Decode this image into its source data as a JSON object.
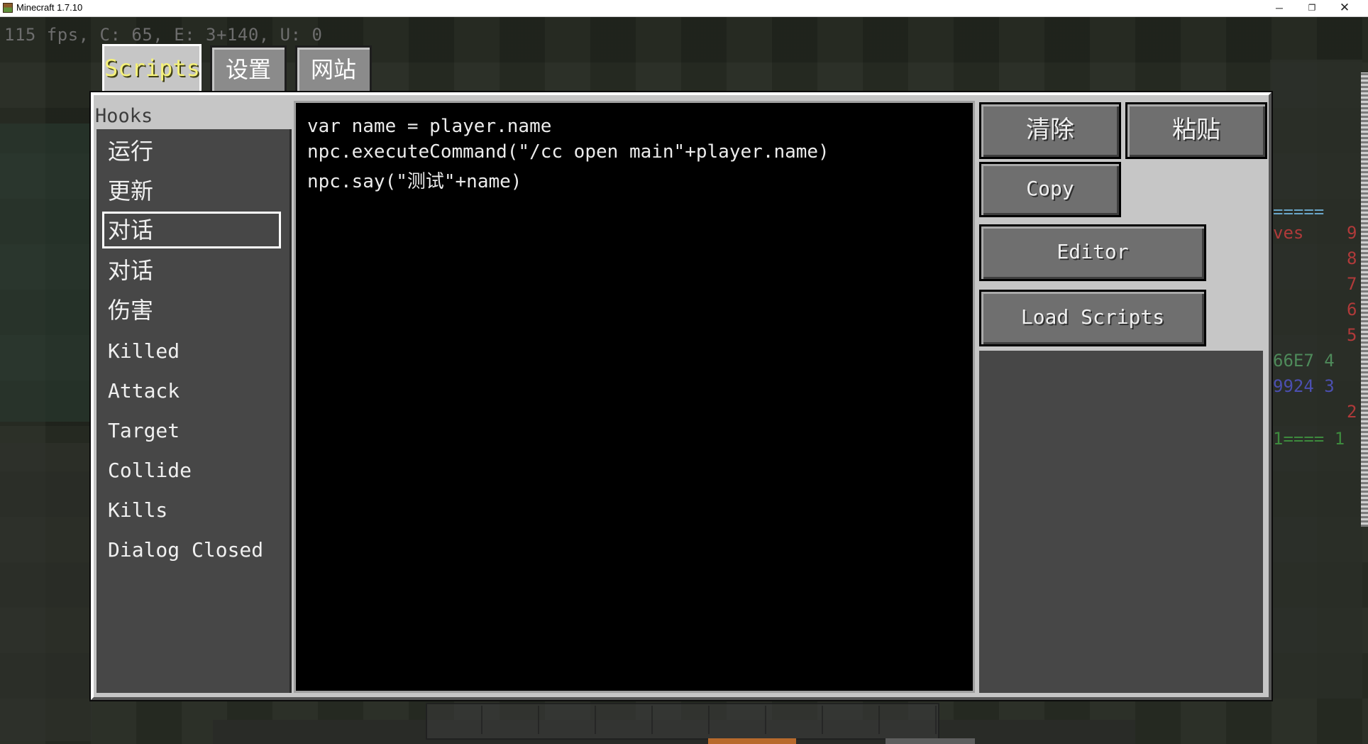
{
  "window": {
    "title": "Minecraft 1.7.10",
    "minimize_glyph": "─",
    "maximize_glyph": "❐",
    "close_glyph": "✕"
  },
  "hud": {
    "debug": "115 fps, C: 65, E: 3+140, U: 0",
    "scoreboard_fragments": [
      "=====",
      "ves",
      "9",
      "8",
      "7",
      "6",
      "5",
      "66E7 4",
      "9924 3",
      "2",
      "1==== 1"
    ]
  },
  "tabs": [
    {
      "label": "Scripts",
      "active": true
    },
    {
      "label": "设置",
      "active": false
    },
    {
      "label": "网站",
      "active": false
    }
  ],
  "hooks": {
    "title": "Hooks",
    "items": [
      {
        "label": "运行",
        "selected": false
      },
      {
        "label": "更新",
        "selected": false
      },
      {
        "label": "对话",
        "selected": true
      },
      {
        "label": "对话",
        "selected": false
      },
      {
        "label": "伤害",
        "selected": false
      },
      {
        "label": "Killed",
        "selected": false
      },
      {
        "label": "Attack",
        "selected": false
      },
      {
        "label": "Target",
        "selected": false
      },
      {
        "label": "Collide",
        "selected": false
      },
      {
        "label": "Kills",
        "selected": false
      },
      {
        "label": "Dialog Closed",
        "selected": false
      }
    ]
  },
  "editor": {
    "lines": [
      "var name = player.name",
      "npc.executeCommand(\"/cc open main\"+player.name)",
      "npc.say(\"测试\"+name)"
    ]
  },
  "buttons": {
    "clear": "清除",
    "paste": "粘贴",
    "copy": "Copy",
    "editor": "Editor",
    "load_scripts": "Load Scripts"
  },
  "colors": {
    "active_tab_text": "#f5f17a",
    "panel_bg": "#c6c6c6",
    "list_bg": "#474747",
    "editor_bg": "#000000",
    "button_bg": "#6f6f6f"
  }
}
